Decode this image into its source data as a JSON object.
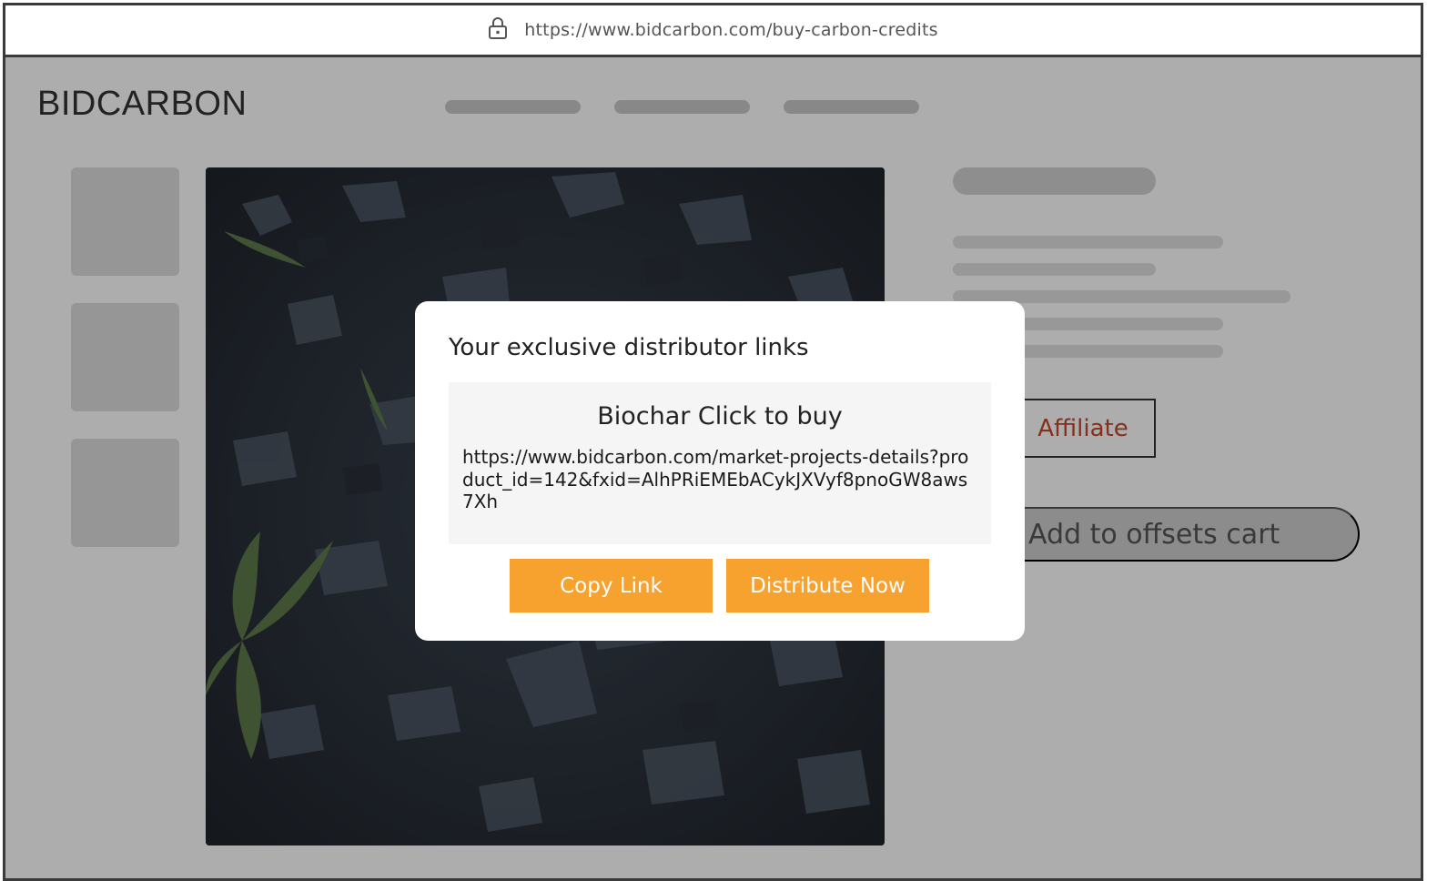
{
  "browser": {
    "url": "https://www.bidcarbon.com/buy-carbon-credits"
  },
  "header": {
    "logo": "BIDCARBON"
  },
  "product": {
    "affiliate_label": "Affiliate",
    "cart_label": "Add to offsets cart"
  },
  "modal": {
    "title": "Your exclusive distributor links",
    "link_heading": "Biochar Click to buy",
    "link_url": "https://www.bidcarbon.com/market-projects-details?product_id=142&fxid=AlhPRiEMEbACykJXVyf8pnoGW8aws7Xh",
    "copy_label": "Copy Link",
    "distribute_label": "Distribute Now"
  },
  "colors": {
    "accent": "#f7a12f",
    "affiliate_text": "#c5462c",
    "overlay": "rgba(0,0,0,0.32)"
  },
  "icons": {
    "lock": "lock-icon"
  }
}
